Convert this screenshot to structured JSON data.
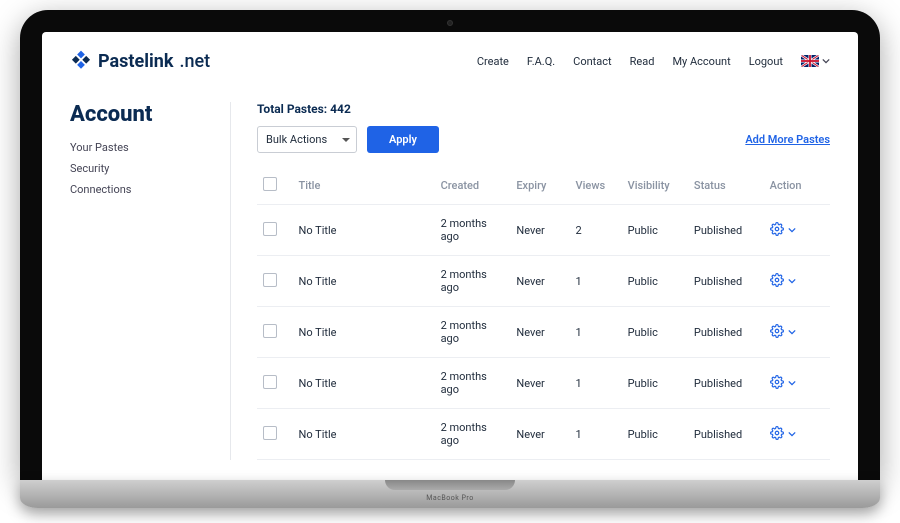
{
  "brand": {
    "name": "Pastelink",
    "tld": ".net"
  },
  "nav": {
    "create": "Create",
    "faq": "F.A.Q.",
    "contact": "Contact",
    "read": "Read",
    "account": "My Account",
    "logout": "Logout"
  },
  "locale": {
    "code": "en-GB",
    "flag": "uk"
  },
  "sidebar": {
    "heading": "Account",
    "items": [
      {
        "label": "Your Pastes"
      },
      {
        "label": "Security"
      },
      {
        "label": "Connections"
      }
    ]
  },
  "summary": {
    "total_label": "Total Pastes:",
    "total_value": "442"
  },
  "toolbar": {
    "bulk_label": "Bulk Actions",
    "apply_label": "Apply",
    "add_more_label": "Add More Pastes"
  },
  "table": {
    "headers": {
      "title": "Title",
      "created": "Created",
      "expiry": "Expiry",
      "views": "Views",
      "visibility": "Visibility",
      "status": "Status",
      "action": "Action"
    },
    "rows": [
      {
        "title": "No Title",
        "created": "2 months ago",
        "expiry": "Never",
        "views": "2",
        "visibility": "Public",
        "status": "Published"
      },
      {
        "title": "No Title",
        "created": "2 months ago",
        "expiry": "Never",
        "views": "1",
        "visibility": "Public",
        "status": "Published"
      },
      {
        "title": "No Title",
        "created": "2 months ago",
        "expiry": "Never",
        "views": "1",
        "visibility": "Public",
        "status": "Published"
      },
      {
        "title": "No Title",
        "created": "2 months ago",
        "expiry": "Never",
        "views": "1",
        "visibility": "Public",
        "status": "Published"
      },
      {
        "title": "No Title",
        "created": "2 months ago",
        "expiry": "Never",
        "views": "1",
        "visibility": "Public",
        "status": "Published"
      }
    ]
  },
  "device": {
    "model": "MacBook Pro"
  },
  "colors": {
    "accent": "#1f63e6",
    "heading": "#0b2b52"
  }
}
